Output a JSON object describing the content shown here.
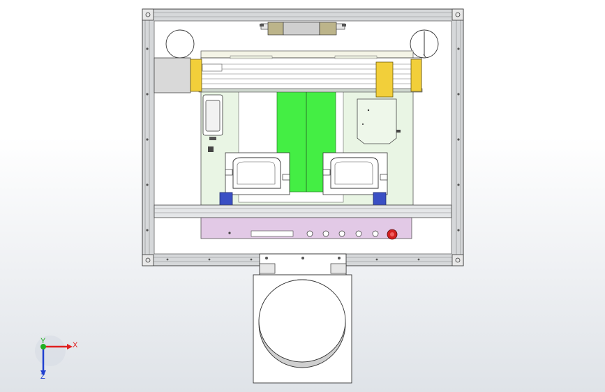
{
  "window": {
    "background_top": "#ffffff",
    "background_bottom": "#dfe3e8"
  },
  "model": {
    "colors": {
      "frame": "#d6d8da",
      "frame_edge": "#5a5a5a",
      "base_plate": "#e9f5e4",
      "conveyor_green": "#44ee44",
      "slide_yellow": "#f2cf3a",
      "block_blue": "#3a4fc4",
      "panel_pink": "#e2c9e6",
      "estop_red": "#d42020",
      "motor_gray": "#d9d9d9",
      "sheet_white": "#ffffff"
    }
  },
  "triad": {
    "x_label": "X",
    "y_label": "Y",
    "z_label": "Z",
    "x_color": "#e02020",
    "y_color": "#20b020",
    "z_color": "#2040d0"
  }
}
